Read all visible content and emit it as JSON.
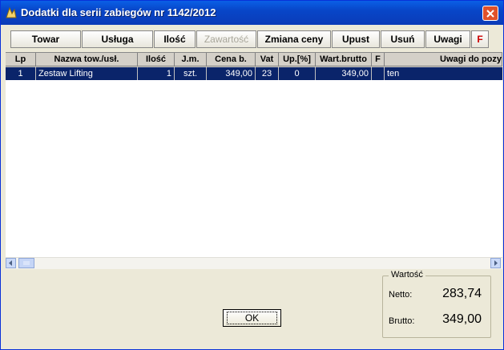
{
  "window": {
    "title": "Dodatki dla serii zabiegów nr 1142/2012"
  },
  "toolbar": {
    "buttons": [
      {
        "label": "Towar"
      },
      {
        "label": "Usługa"
      },
      {
        "label": "Ilość"
      },
      {
        "label": "Zawartość"
      },
      {
        "label": "Zmiana ceny"
      },
      {
        "label": "Upust"
      },
      {
        "label": "Usuń"
      },
      {
        "label": "Uwagi"
      },
      {
        "label": "F"
      }
    ]
  },
  "grid": {
    "columns": [
      "Lp",
      "Nazwa tow./usł.",
      "Ilość",
      "J.m.",
      "Cena b.",
      "Vat",
      "Up.[%]",
      "Wart.brutto",
      "F",
      "Uwagi do pozy"
    ],
    "rows": [
      [
        "1",
        "Zestaw Lifting",
        "1",
        "szt.",
        "349,00",
        "23",
        "0",
        "349,00",
        "",
        "ten"
      ]
    ],
    "selected_row": 0
  },
  "summary": {
    "legend": "Wartość",
    "netto_label": "Netto:",
    "netto_value": "283,74",
    "brutto_label": "Brutto:",
    "brutto_value": "349,00"
  },
  "ok_button": {
    "label": "OK"
  },
  "colors": {
    "titlebar": "#0a3bb8",
    "selection": "#0a246a",
    "close": "#e0512b"
  }
}
